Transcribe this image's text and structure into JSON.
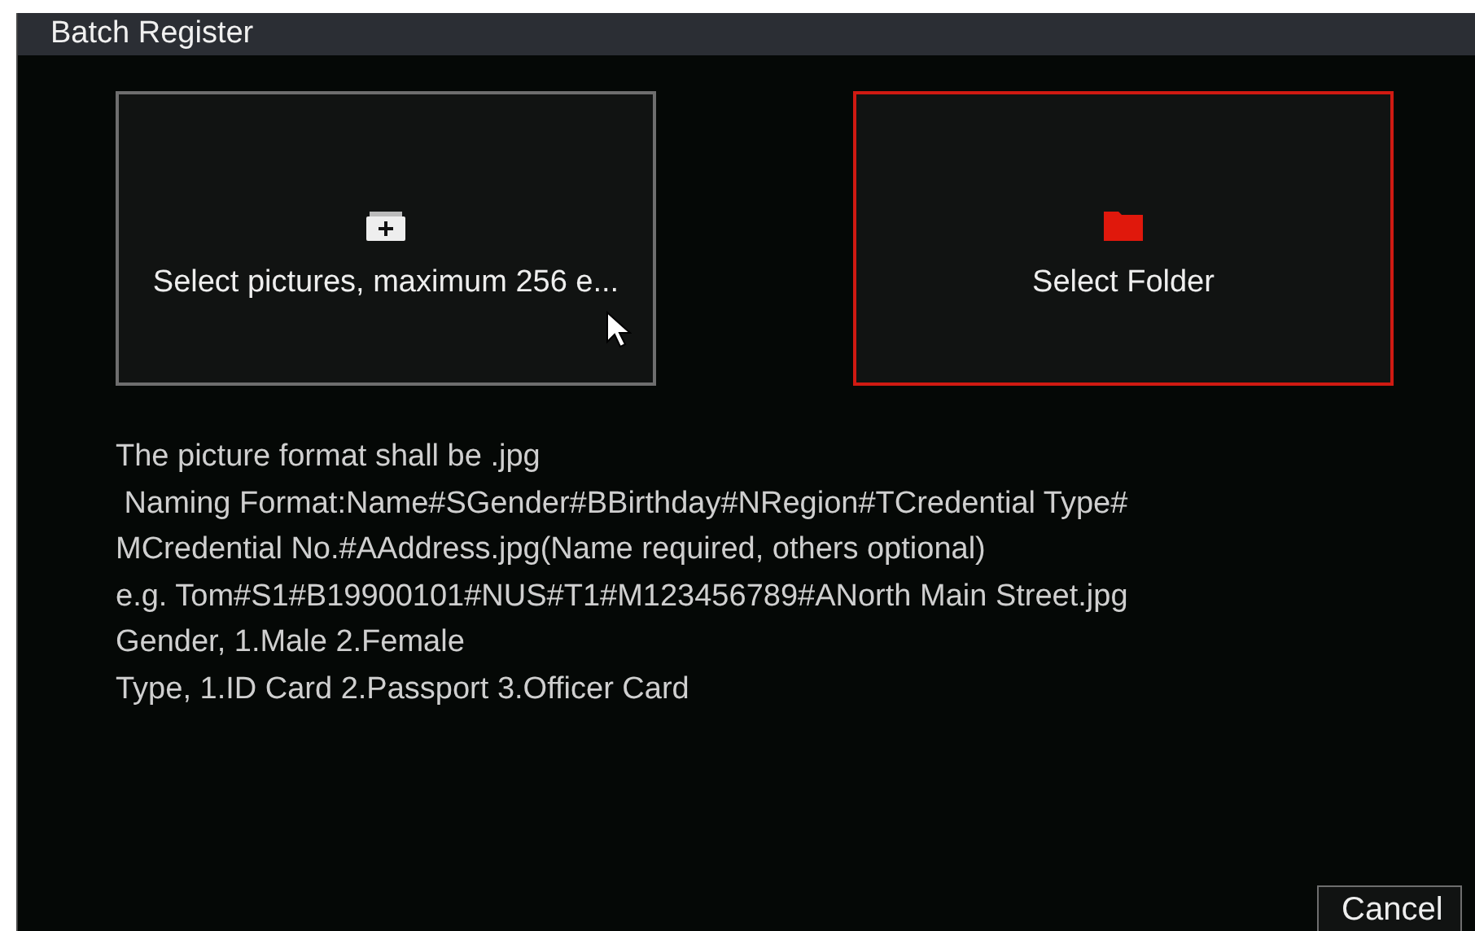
{
  "window": {
    "title": "Batch Register"
  },
  "tiles": [
    {
      "kind": "add",
      "label": "Select pictures, maximum 256 e...",
      "selected": false
    },
    {
      "kind": "folder",
      "label": "Select Folder",
      "selected": true
    }
  ],
  "instructions": [
    "The picture format shall be .jpg",
    " Naming Format:Name#SGender#BBirthday#NRegion#TCredential Type#",
    "MCredential No.#AAddress.jpg(Name required, others optional)",
    "e.g. Tom#S1#B19900101#NUS#T1#M123456789#ANorth Main Street.jpg",
    "Gender, 1.Male 2.Female",
    "Type, 1.ID Card 2.Passport 3.Officer Card"
  ],
  "buttons": [
    "Cancel"
  ]
}
